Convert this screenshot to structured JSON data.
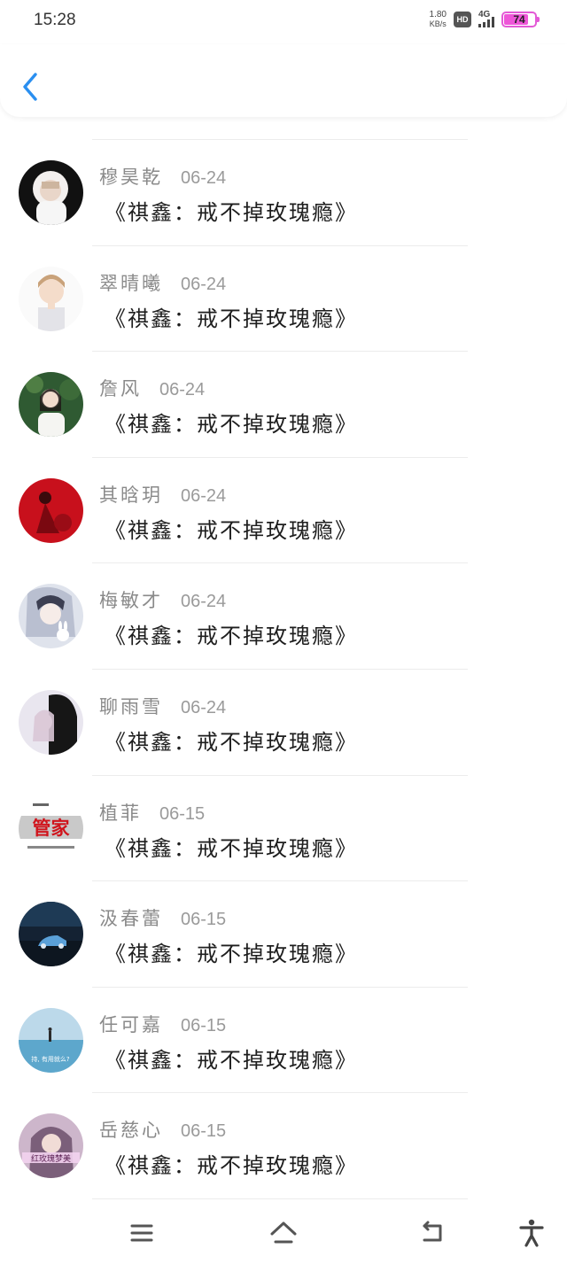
{
  "status_bar": {
    "time": "15:28",
    "net_speed_value": "1.80",
    "net_speed_unit": "KB/s",
    "hd_label": "HD",
    "network_label": "4G",
    "battery_percent": "74",
    "battery_level": 0.74,
    "battery_color": "#ee55d8"
  },
  "header": {
    "back_icon": "chevron-left-icon",
    "accent_color": "#2a8ff0"
  },
  "items": [
    {
      "name": "穆昊乾",
      "date": "06-24",
      "title": "《祺鑫：戒不掉玫瑰瘾》",
      "avatar": "girl-white-hood-avatar"
    },
    {
      "name": "翠晴曦",
      "date": "06-24",
      "title": "《祺鑫：戒不掉玫瑰瘾》",
      "avatar": "anime-boy-avatar"
    },
    {
      "name": "詹风",
      "date": "06-24",
      "title": "《祺鑫：戒不掉玫瑰瘾》",
      "avatar": "girl-garden-avatar"
    },
    {
      "name": "其晗玥",
      "date": "06-24",
      "title": "《祺鑫：戒不掉玫瑰瘾》",
      "avatar": "red-dress-avatar"
    },
    {
      "name": "梅敏才",
      "date": "06-24",
      "title": "《祺鑫：戒不掉玫瑰瘾》",
      "avatar": "anime-girl-rabbit-avatar"
    },
    {
      "name": "聊雨雪",
      "date": "06-24",
      "title": "《祺鑫：戒不掉玫瑰瘾》",
      "avatar": "couple-dark-avatar"
    },
    {
      "name": "植菲",
      "date": "06-15",
      "title": "《祺鑫：戒不掉玫瑰瘾》",
      "avatar": "text-logo-avatar",
      "avatar_text": "管家"
    },
    {
      "name": "汲春蕾",
      "date": "06-15",
      "title": "《祺鑫：戒不掉玫瑰瘾》",
      "avatar": "night-car-avatar"
    },
    {
      "name": "任可嘉",
      "date": "06-15",
      "title": "《祺鑫：戒不掉玫瑰瘾》",
      "avatar": "sea-figure-avatar"
    },
    {
      "name": "岳慈心",
      "date": "06-15",
      "title": "《祺鑫：戒不掉玫瑰瘾》",
      "avatar": "hooded-girl-avatar"
    }
  ],
  "bottom_nav": {
    "menu_icon": "menu-icon",
    "home_icon": "home-icon",
    "back_icon": "back-arrow-icon",
    "accessibility_icon": "accessibility-icon"
  }
}
